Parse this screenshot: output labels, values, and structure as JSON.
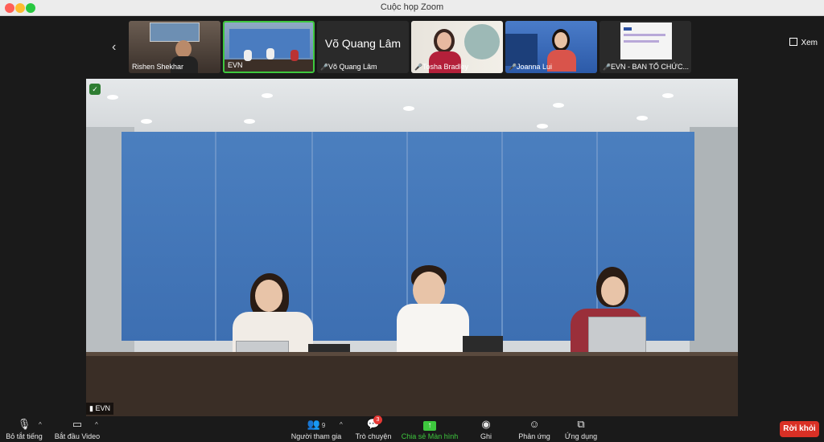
{
  "window": {
    "title": "Cuộc họp Zoom"
  },
  "gallery": {
    "view_label": "Xem",
    "tiles": [
      {
        "name": "Rishen Shekhar"
      },
      {
        "name": "EVN"
      },
      {
        "name": "Võ Quang Lâm",
        "display_name": "Võ Quang Lâm"
      },
      {
        "name": "Tosha Bradley"
      },
      {
        "name": "Joanna Lui"
      },
      {
        "name": "EVN - BAN TỔ CHỨC..."
      }
    ]
  },
  "main_video": {
    "label": "EVN"
  },
  "toolbar": {
    "mute": "Bỏ tắt tiếng",
    "video": "Bắt đầu Video",
    "participants": "Người tham gia",
    "participant_count": "9",
    "chat": "Trò chuyện",
    "chat_badge": "3",
    "share": "Chia sẻ Màn hình",
    "record": "Ghi",
    "reactions": "Phản ứng",
    "apps": "Ứng dụng",
    "leave": "Rời khỏi"
  },
  "colors": {
    "accent": "#3ec83e",
    "leave": "#d93025"
  }
}
